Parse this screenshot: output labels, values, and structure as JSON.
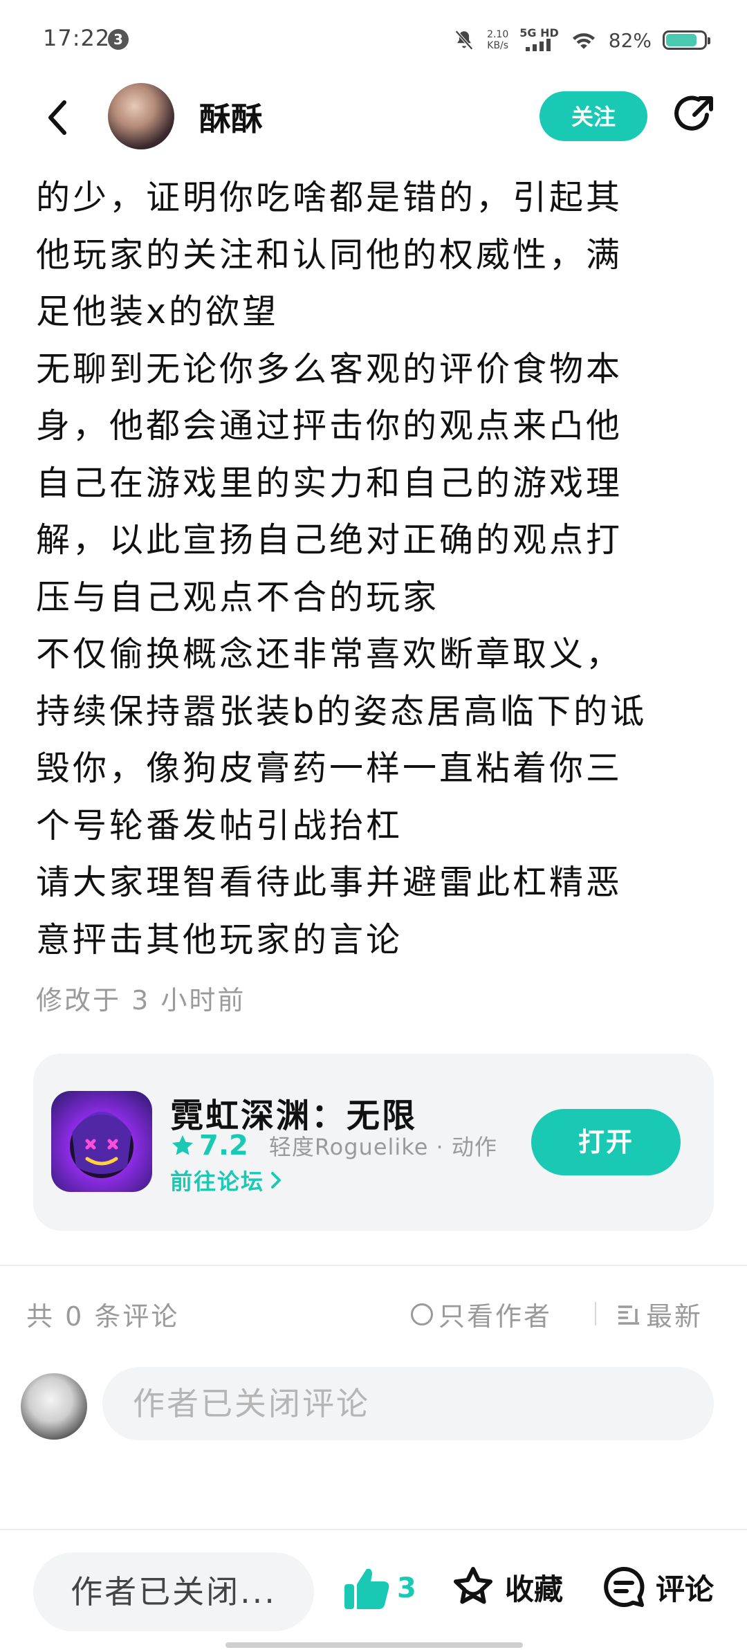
{
  "status_bar": {
    "time": "17:22",
    "notification_count": "3",
    "net_speed_value": "2.10",
    "net_speed_unit": "KB/s",
    "network": "5G HD",
    "battery_percent": "82%",
    "battery_level": 0.82
  },
  "header": {
    "user_name": "酥酥",
    "follow_label": "关注"
  },
  "article": {
    "lines": [
      "的少，证明你吃啥都是错的，引起其",
      "他玩家的关注和认同他的权威性，满",
      "足他装x的欲望",
      "无聊到无论你多么客观的评价食物本",
      "身，他都会通过抨击你的观点来凸他",
      "自己在游戏里的实力和自己的游戏理",
      "解，以此宣扬自己绝对正确的观点打",
      "压与自己观点不合的玩家",
      "不仅偷换概念还非常喜欢断章取义，",
      "持续保持嚣张装b的姿态居高临下的诋",
      "毁你，像狗皮膏药一样一直粘着你三",
      "个号轮番发帖引战抬杠",
      "请大家理智看待此事并避雷此杠精恶",
      "意抨击其他玩家的言论"
    ],
    "modified": "修改于 3 小时前"
  },
  "game_card": {
    "title": "霓虹深渊：无限",
    "rating": "7.2",
    "tags": "轻度Roguelike · 动作",
    "forum_link": "前往论坛",
    "open_label": "打开"
  },
  "comments": {
    "count_label": "共 0 条评论",
    "only_author_label": "只看作者",
    "sort_label": "最新",
    "input_placeholder": "作者已关闭评论"
  },
  "bottom_bar": {
    "input_label": "作者已关闭...",
    "like_count": "3",
    "favorite_label": "收藏",
    "comment_label": "评论"
  },
  "colors": {
    "accent": "#19c9b4",
    "text_primary": "#111111",
    "text_secondary": "#9a9a9a",
    "card_bg": "#f2f4f5"
  },
  "icons": [
    "bell-muted-icon",
    "wifi-icon",
    "battery-icon",
    "back-arrow-icon",
    "share-icon",
    "star-icon",
    "chevron-right-icon",
    "radio-icon",
    "sort-icon",
    "thumbs-up-icon",
    "star-outline-icon",
    "comment-bubble-icon"
  ]
}
